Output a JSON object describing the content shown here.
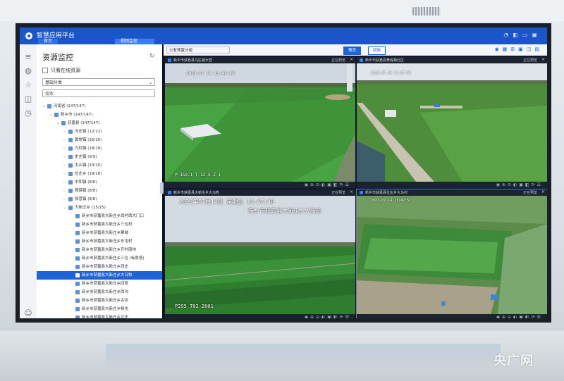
{
  "app": {
    "title": "智慧应用平台",
    "tabs": [
      "首页",
      "视频监控"
    ]
  },
  "sidebar_icons": [
    "menu-icon",
    "globe-icon",
    "star-icon",
    "layout-icon",
    "clock-icon",
    "user-icon"
  ],
  "panel": {
    "title": "资源监控",
    "checkbox_label": "只看在线资源",
    "select_value": "基础分类",
    "search_placeholder": "搜索",
    "tree": [
      {
        "level": 0,
        "toggle": "⌄",
        "label": "河南省 (147/147)"
      },
      {
        "level": 1,
        "toggle": "⌄",
        "label": "新乡市 (147/147)"
      },
      {
        "level": 2,
        "toggle": "⌄",
        "label": "获嘉县 (147/147)"
      },
      {
        "level": 3,
        "toggle": "›",
        "label": "冯庄镇 (12/12)"
      },
      {
        "level": 3,
        "toggle": "›",
        "label": "黄堤镇 (16/16)"
      },
      {
        "level": 3,
        "toggle": "›",
        "label": "亢村镇 (18/18)"
      },
      {
        "level": 3,
        "toggle": "›",
        "label": "史庄镇 (9/9)"
      },
      {
        "level": 3,
        "toggle": "›",
        "label": "太山镇 (10/10)"
      },
      {
        "level": 3,
        "toggle": "›",
        "label": "位庄乡 (18/18)"
      },
      {
        "level": 3,
        "toggle": "›",
        "label": "中和镇 (8/8)"
      },
      {
        "level": 3,
        "toggle": "›",
        "label": "照镜镇 (8/8)"
      },
      {
        "level": 3,
        "toggle": "›",
        "label": "徐营镇 (8/8)"
      },
      {
        "level": 3,
        "toggle": "⌄",
        "label": "大新庄乡 (15/15)"
      },
      {
        "level": 4,
        "toggle": "",
        "label": "新乡市获嘉县大新庄乡西村西大门口"
      },
      {
        "level": 4,
        "toggle": "",
        "label": "新乡市获嘉县大新庄乡三位村"
      },
      {
        "level": 4,
        "toggle": "",
        "label": "新乡市获嘉县大新庄乡寨城"
      },
      {
        "level": 4,
        "toggle": "",
        "label": "新乡市获嘉县大新庄乡东屯村"
      },
      {
        "level": 4,
        "toggle": "",
        "label": "新乡市获嘉县大新庄乡齐村南地"
      },
      {
        "level": 4,
        "toggle": "",
        "label": "新乡市获嘉县大新庄乡三位 (标景塔)"
      },
      {
        "level": 4,
        "toggle": "",
        "label": "新乡市获嘉县大新庄乡西庄"
      },
      {
        "level": 4,
        "toggle": "",
        "label": "新乡市获嘉县大新庄乡大马牧",
        "selected": true
      },
      {
        "level": 4,
        "toggle": "",
        "label": "新乡市获嘉县大新庄乡四段"
      },
      {
        "level": 4,
        "toggle": "",
        "label": "新乡市获嘉县大新庄乡西沟"
      },
      {
        "level": 4,
        "toggle": "",
        "label": "新乡市获嘉县大新庄乡古坟"
      },
      {
        "level": 4,
        "toggle": "",
        "label": "新乡市获嘉县大新庄乡杨屯"
      },
      {
        "level": 4,
        "toggle": "",
        "label": "新乡市获嘉县大新庄乡北庄"
      },
      {
        "level": 4,
        "toggle": "",
        "label": "新乡市获嘉县大新庄乡北大新庄"
      }
    ]
  },
  "toolbar": {
    "select_value": "公有预置分组",
    "btn_primary": "预览",
    "btn_secondary": "回放"
  },
  "cameras": [
    {
      "title": "新乡市获嘉县乌庄镇大营",
      "right": "正在预览",
      "osd_top": "2023-07-14 11:47:48",
      "osd_bottom": "P 159.1  T 12.5  Z 1"
    },
    {
      "title": "新乡市获嘉县黄堤镇北区",
      "right": "正在预览",
      "osd_top": "2023-07-14 11:47:51",
      "osd_bottom": ""
    },
    {
      "title": "新乡市获嘉县大新庄乡大马牧",
      "right": "正在预览",
      "osd_top": "2023年07月14日  星期五  11:47:48",
      "osd_sub": "新乡市获嘉县大新庄乡大新庄",
      "osd_bottom": "P295  T02     2001"
    },
    {
      "title": "新乡市获嘉县位庄乡大马村",
      "right": "正在预览",
      "osd_top": "2023-07-14 11:47:51",
      "osd_bottom": ""
    }
  ],
  "watermark": "央广网"
}
